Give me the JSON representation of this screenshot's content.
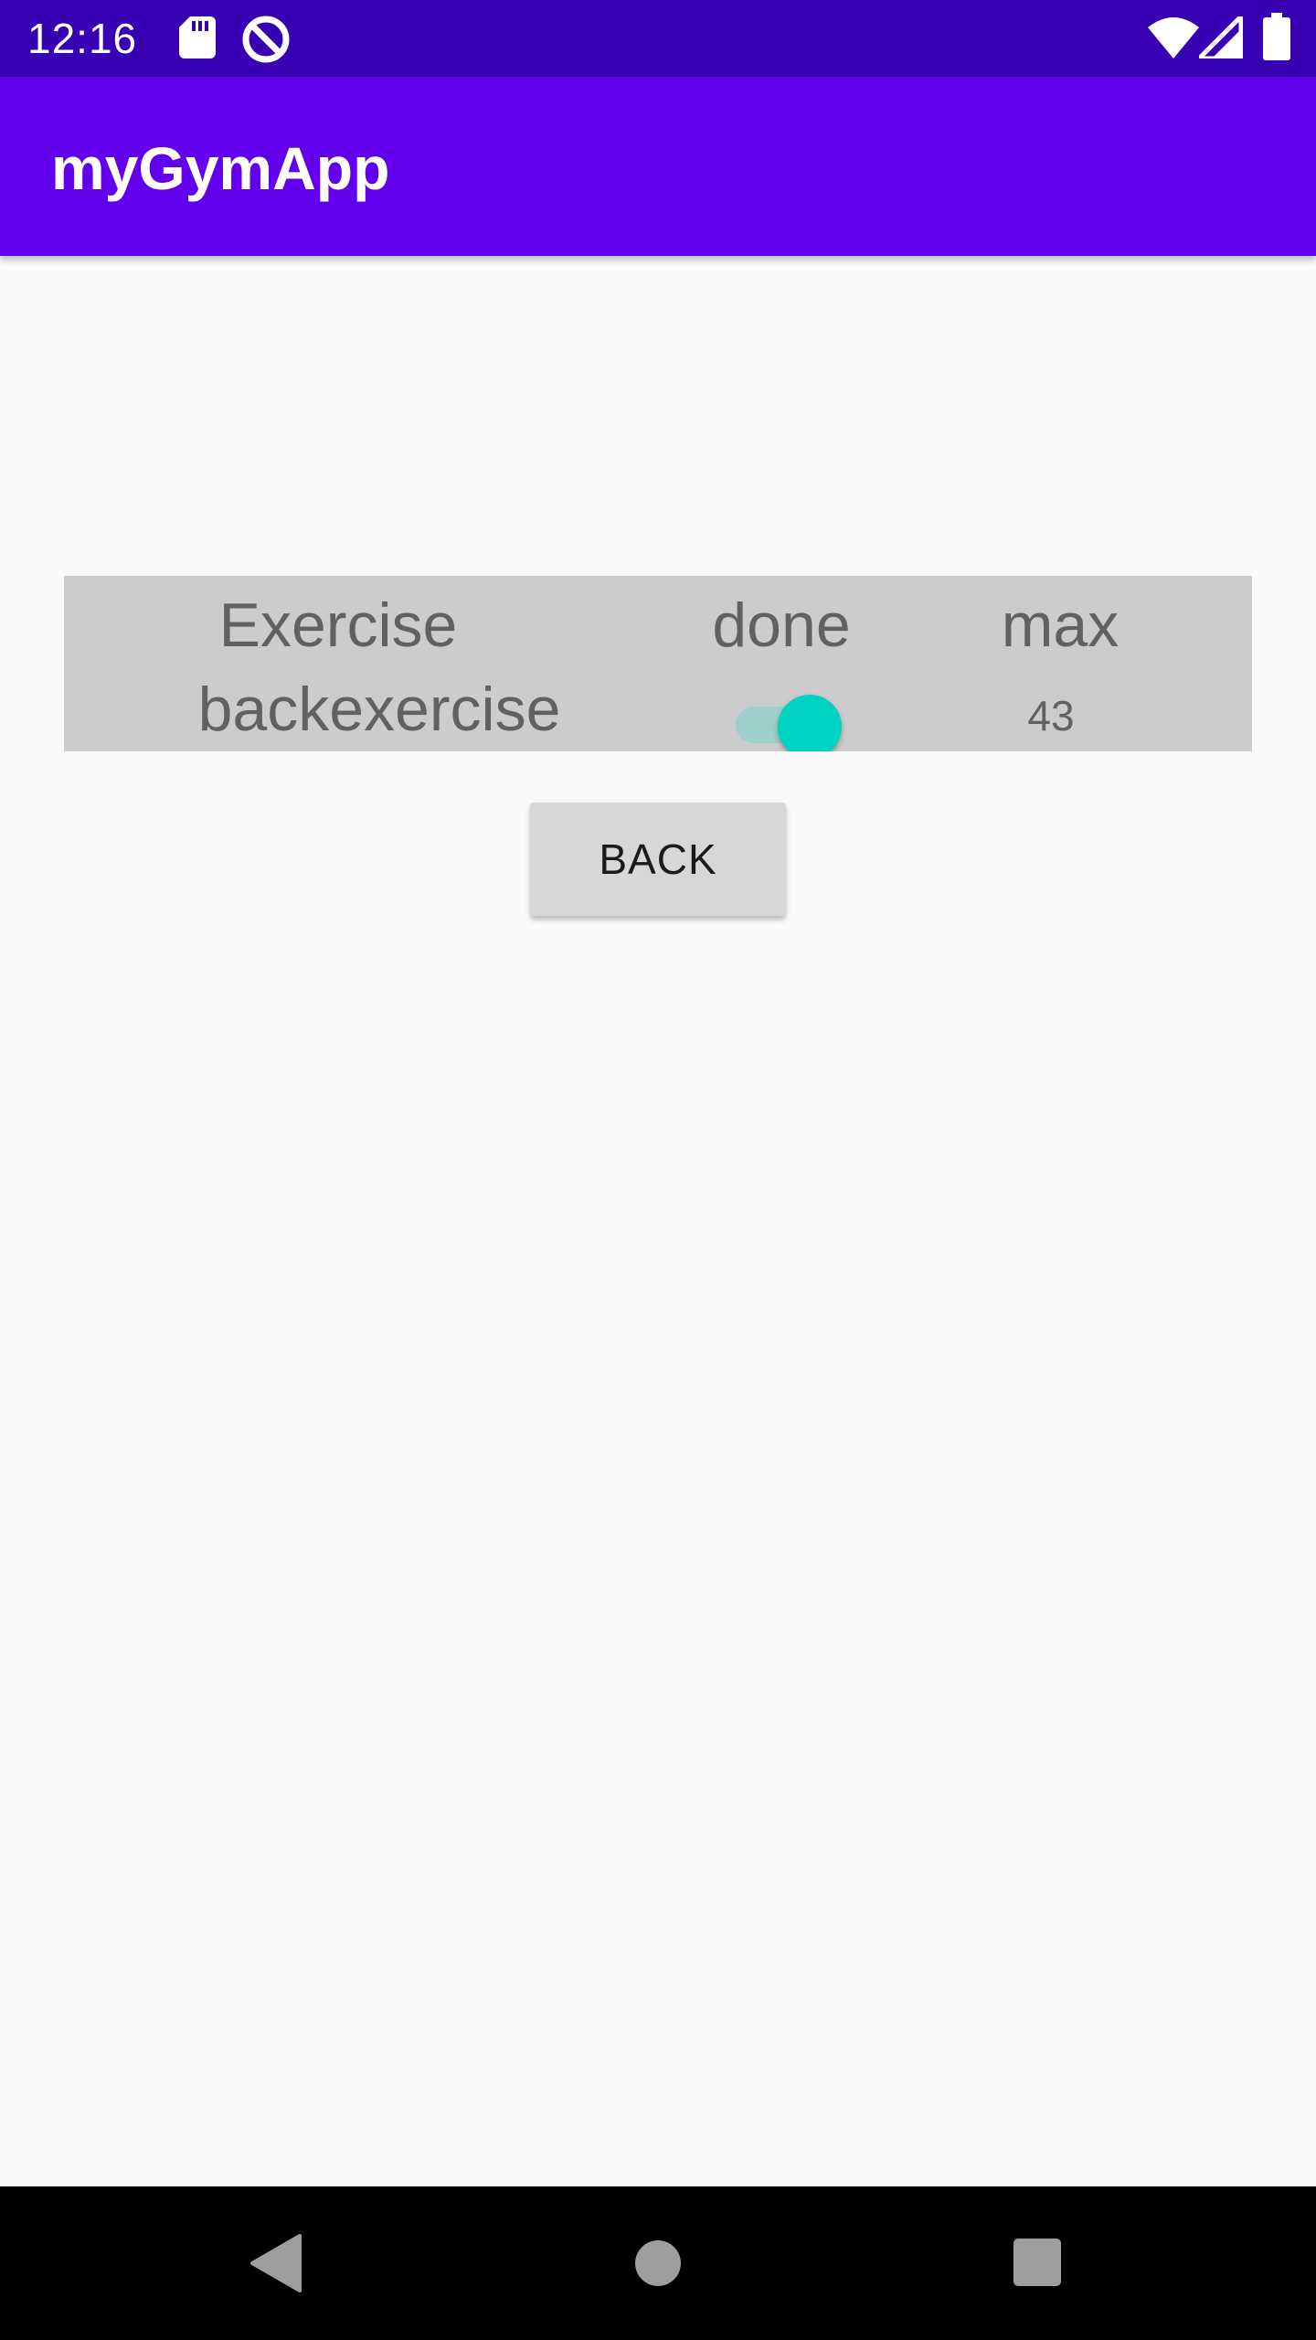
{
  "status_bar": {
    "time": "12:16",
    "icons": [
      "sd-card-icon",
      "do-not-disturb-icon",
      "wifi-icon",
      "cell-signal-icon",
      "battery-icon"
    ],
    "background": "#3700b3"
  },
  "app_bar": {
    "title": "myGymApp",
    "background": "#6200ee"
  },
  "table": {
    "headers": {
      "exercise": "Exercise",
      "done": "done",
      "max": "max"
    },
    "rows": [
      {
        "exercise": "backexercise",
        "done": true,
        "max": "43"
      }
    ],
    "background": "#cccccc",
    "switch_color": "#00d3c1"
  },
  "back_button": {
    "label": "BACK"
  },
  "nav_bar": {
    "buttons": [
      "back-icon",
      "home-icon",
      "recents-icon"
    ]
  }
}
